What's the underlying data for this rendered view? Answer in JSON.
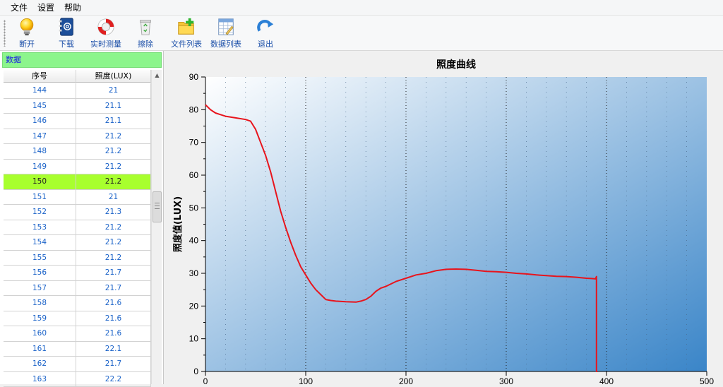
{
  "menu": {
    "items": [
      "文件",
      "设置",
      "帮助"
    ]
  },
  "toolbar": {
    "buttons": [
      {
        "label": "断开",
        "icon": "lightbulb-icon"
      },
      {
        "label": "下载",
        "icon": "address-book-icon"
      },
      {
        "label": "实时测量",
        "icon": "lifebuoy-icon"
      },
      {
        "label": "擦除",
        "icon": "recycle-bin-icon"
      },
      {
        "label": "文件列表",
        "icon": "folder-add-icon"
      },
      {
        "label": "数据列表",
        "icon": "spreadsheet-icon"
      },
      {
        "label": "退出",
        "icon": "redo-arrow-icon"
      }
    ]
  },
  "data_panel": {
    "title": "数据",
    "columns": [
      "序号",
      "照度(LUX)"
    ],
    "rows": [
      [
        "144",
        "21"
      ],
      [
        "145",
        "21.1"
      ],
      [
        "146",
        "21.1"
      ],
      [
        "147",
        "21.2"
      ],
      [
        "148",
        "21.2"
      ],
      [
        "149",
        "21.2"
      ],
      [
        "150",
        "21.2"
      ],
      [
        "151",
        "21"
      ],
      [
        "152",
        "21.3"
      ],
      [
        "153",
        "21.2"
      ],
      [
        "154",
        "21.2"
      ],
      [
        "155",
        "21.2"
      ],
      [
        "156",
        "21.7"
      ],
      [
        "157",
        "21.7"
      ],
      [
        "158",
        "21.6"
      ],
      [
        "159",
        "21.6"
      ],
      [
        "160",
        "21.6"
      ],
      [
        "161",
        "22.1"
      ],
      [
        "162",
        "21.7"
      ],
      [
        "163",
        "22.2"
      ]
    ],
    "selected_row": "150",
    "colors": {
      "header_bg": "#8cf58c",
      "selected_bg": "#a8ff2e",
      "cell_text": "#1a62c8"
    }
  },
  "chart_data": {
    "type": "line",
    "title": "照度曲线",
    "xlabel": "",
    "ylabel": "照度值(LUX)",
    "xlim": [
      0,
      500
    ],
    "ylim": [
      0,
      90
    ],
    "xticks": [
      0,
      100,
      200,
      300,
      400,
      500
    ],
    "yticks": [
      0,
      10,
      20,
      30,
      40,
      50,
      60,
      70,
      80,
      90
    ],
    "grid": true,
    "series": [
      {
        "color": "#e8141c",
        "x": [
          0,
          5,
          10,
          15,
          20,
          30,
          40,
          45,
          50,
          55,
          60,
          65,
          70,
          75,
          80,
          85,
          90,
          95,
          100,
          105,
          110,
          115,
          120,
          125,
          130,
          140,
          150,
          155,
          160,
          165,
          170,
          175,
          180,
          190,
          200,
          210,
          220,
          230,
          240,
          250,
          260,
          270,
          280,
          290,
          300,
          310,
          320,
          330,
          340,
          350,
          360,
          370,
          380,
          385,
          389,
          390,
          390,
          391
        ],
        "y": [
          81.5,
          80,
          79,
          78.5,
          78,
          77.5,
          77,
          76.5,
          74,
          70,
          66,
          61,
          55,
          49,
          44,
          39.5,
          35.5,
          32,
          29.5,
          27,
          25,
          23.5,
          22,
          21.7,
          21.5,
          21.3,
          21.2,
          21.5,
          22,
          23,
          24.5,
          25.5,
          26,
          27.5,
          28.5,
          29.5,
          30,
          30.8,
          31.2,
          31.3,
          31.2,
          30.9,
          30.6,
          30.5,
          30.3,
          30,
          29.8,
          29.5,
          29.3,
          29.1,
          29,
          28.8,
          28.5,
          28.4,
          28.3,
          29,
          0,
          0
        ]
      }
    ],
    "background": {
      "from": "#ffffff",
      "to": "#3a85c8"
    }
  }
}
